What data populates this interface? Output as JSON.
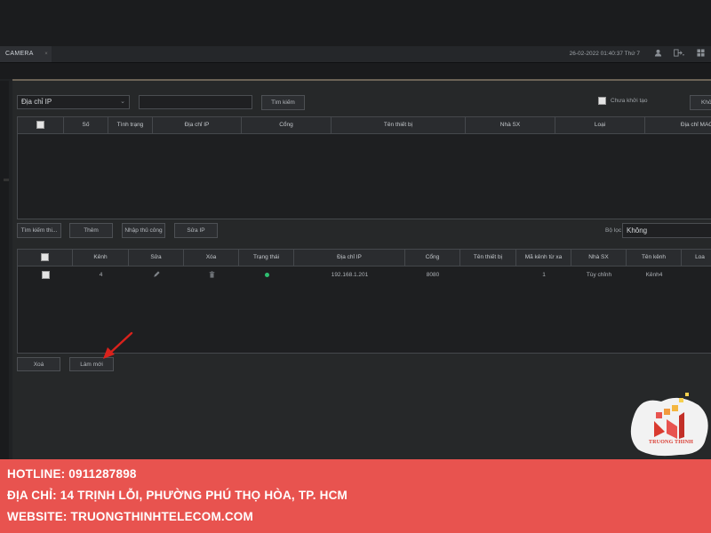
{
  "titlebar": {
    "tab_label": "CAMERA",
    "tab_close": "×",
    "datetime": "26-02-2022 01:40:37 Thứ 7",
    "icons": [
      "user-icon",
      "logout-icon",
      "layout-grid-icon"
    ]
  },
  "search": {
    "filter_select": "Địa chỉ IP",
    "query_value": "",
    "search_button": "Tìm kiếm",
    "uninit_label": "Chưa khởi tạo",
    "right_button_partial": "Khở"
  },
  "devices_table": {
    "columns": [
      "",
      "Số",
      "Tình trạng",
      "Địa chỉ IP",
      "Cổng",
      "Tên thiết bị",
      "Nhà SX",
      "Loại",
      "Địa chỉ MAC"
    ],
    "rows": []
  },
  "actions": {
    "find_button": "Tìm kiếm thi...",
    "add_button": "Thêm",
    "manual_button": "Nhập thủ công",
    "edit_ip_button": "Sửa IP",
    "filter_label": "Bộ lọc",
    "filter_value": "Không"
  },
  "channels_table": {
    "columns": [
      "",
      "Kênh",
      "Sửa",
      "Xóa",
      "Trạng thái",
      "Địa chỉ IP",
      "Cổng",
      "Tên thiết bị",
      "Mã kênh từ xa",
      "Nhà SX",
      "Tên kênh",
      "Loa"
    ],
    "rows": [
      {
        "channel": "4",
        "ip": "192.168.1.201",
        "port": "8080",
        "device_name": "",
        "remote_channel": "1",
        "manufacturer": "Tùy chỉnh",
        "channel_name": "Kênh4",
        "status": "online"
      }
    ]
  },
  "bottom": {
    "delete_button": "Xoá",
    "refresh_button": "Làm mới"
  },
  "banner": {
    "hotline": "HOTLINE: 0911287898",
    "address": "ĐỊA CHỈ: 14 TRỊNH LỖI, PHƯỜNG PHÚ THỌ HÒA, TP. HCM",
    "website": "WEBSITE: TRUONGTHINHTELECOM.COM"
  },
  "logo": {
    "text": "TRUONG THINH"
  },
  "colors": {
    "banner": "#e8534f",
    "status_online": "#2fbf71",
    "arrow": "#d9221c"
  }
}
